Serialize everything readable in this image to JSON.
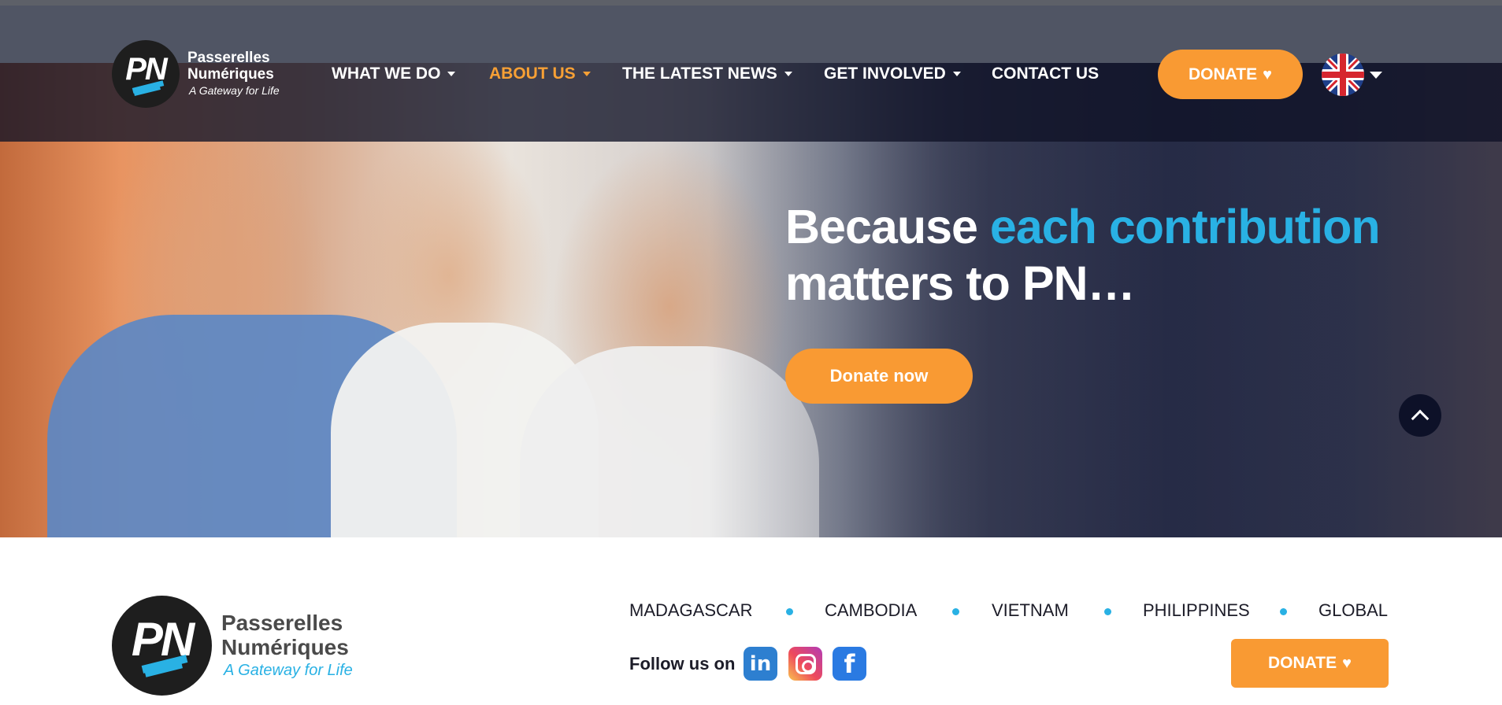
{
  "brand": {
    "logo_initials": "PN",
    "name_line1": "Passerelles",
    "name_line2": "Numériques",
    "tagline": "A Gateway for Life"
  },
  "nav": {
    "items": [
      {
        "label": "WHAT WE DO",
        "has_dropdown": true,
        "active": false
      },
      {
        "label": "ABOUT US",
        "has_dropdown": true,
        "active": true
      },
      {
        "label": "THE LATEST NEWS",
        "has_dropdown": true,
        "active": false
      },
      {
        "label": "GET INVOLVED",
        "has_dropdown": true,
        "active": false
      },
      {
        "label": "CONTACT US",
        "has_dropdown": false,
        "active": false
      }
    ],
    "donate_label": "DONATE",
    "language_icon": "uk-flag-icon"
  },
  "hero": {
    "headline_part1": "Because ",
    "headline_accent": "each contribution",
    "headline_part2": "matters to PN…",
    "cta_label": "Donate now"
  },
  "footer": {
    "countries": [
      "MADAGASCAR",
      "CAMBODIA",
      "VIETNAM",
      "PHILIPPINES",
      "GLOBAL"
    ],
    "follow_label": "Follow us on",
    "social": [
      "linkedin-icon",
      "instagram-icon",
      "facebook-icon"
    ],
    "donate_label": "DONATE"
  },
  "colors": {
    "accent_orange": "#f99a33",
    "accent_blue": "#29b1e4",
    "nav_active": "#f7a035",
    "scroll_top_bg": "#0d1128"
  }
}
